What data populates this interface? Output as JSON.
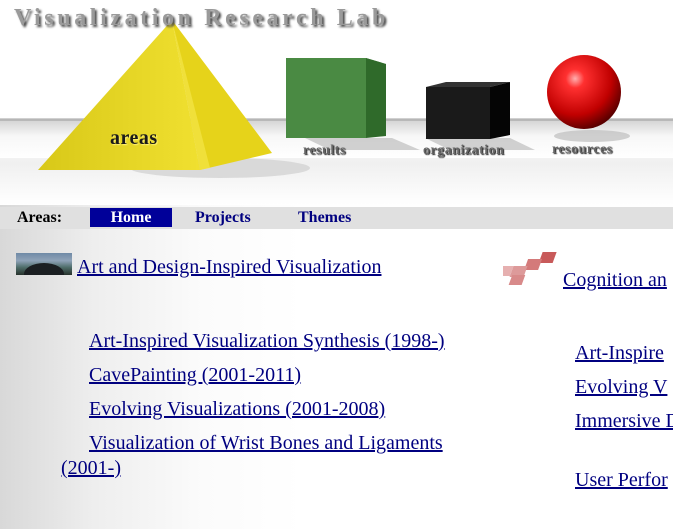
{
  "banner": {
    "title": "Visualization Research Lab",
    "labels": {
      "areas": "areas",
      "results": "results",
      "organization": "organization",
      "resources": "resources"
    },
    "colors": {
      "pyramid": "#e8d820",
      "cube_green": "#3f7f3a",
      "cube_black": "#111111",
      "sphere": "#d60000"
    }
  },
  "nav": {
    "label": "Areas:",
    "items": [
      {
        "label": "Home",
        "active": true
      },
      {
        "label": "Projects",
        "active": false
      },
      {
        "label": "Themes",
        "active": false
      }
    ],
    "active_color": "#000099",
    "bar_color": "#e0e0e0"
  },
  "areas": [
    {
      "heading": " Art and Design-Inspired Visualization",
      "thumbnail_icon": "art-thumbnail",
      "projects": [
        "Art-Inspired Visualization Synthesis (1998-)",
        "CavePainting (2001-2011)",
        "Evolving Visualizations (2001-2008)",
        "Visualization of Wrist Bones and Ligaments (2001-)"
      ]
    },
    {
      "heading": " Cognition an",
      "thumbnail_icon": "cognition-thumbnail",
      "projects": [
        "Art-Inspire",
        "Evolving V",
        "Immersive Data Analysis",
        "User Perfor"
      ]
    }
  ],
  "link_color": "#000080"
}
